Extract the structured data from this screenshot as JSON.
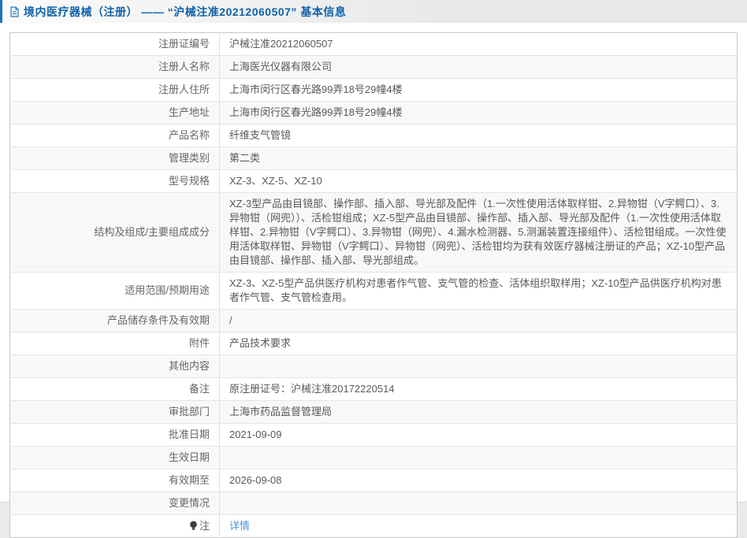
{
  "header": {
    "title": "境内医疗器械（注册） —— “沪械注准20212060507” 基本信息"
  },
  "colors": {
    "title_blue": "#0f62a7",
    "accent_border_blue": "#2272b9",
    "link_blue": "#4e94d9",
    "page_bg": "#eaeaea",
    "table_outer_border": "#c8c8c8",
    "row_divider": "#e4e4e4",
    "text_gray": "#595959"
  },
  "table": {
    "rows": [
      {
        "label": "注册证编号",
        "value": "沪械注准20212060507"
      },
      {
        "label": "注册人名称",
        "value": "上海医光仪器有限公司"
      },
      {
        "label": "注册人住所",
        "value": "上海市闵行区春光路99弄18号29幢4楼"
      },
      {
        "label": "生产地址",
        "value": "上海市闵行区春光路99弄18号29幢4楼"
      },
      {
        "label": "产品名称",
        "value": "纤维支气管镜"
      },
      {
        "label": "管理类别",
        "value": "第二类"
      },
      {
        "label": "型号规格",
        "value": "XZ-3、XZ-5、XZ-10"
      },
      {
        "label": "结构及组成/主要组成成分",
        "value": "XZ-3型产品由目镜部、操作部、插入部、导光部及配件（1.一次性使用活体取样钳、2.异物钳（V字鳄口）、3.异物钳（网兜））、活检钳组成；XZ-5型产品由目镜部、操作部、插入部、导光部及配件（1.一次性使用活体取样钳、2.异物钳（V字鳄口）、3.异物钳（网兜）、4.漏水检测器、5.测漏装置连接组件）、活检钳组成。一次性使用活体取样钳、异物钳（V字鳄口）、异物钳（网兜）、活检钳均为获有效医疗器械注册证的产品；XZ-10型产品由目镜部、操作部、插入部、导光部组成。"
      },
      {
        "label": "适用范围/预期用途",
        "value": "XZ-3、XZ-5型产品供医疗机构对患者作气管、支气管的检查、活体组织取样用；XZ-10型产品供医疗机构对患者作气管、支气管检查用。"
      },
      {
        "label": "产品储存条件及有效期",
        "value": "/"
      },
      {
        "label": "附件",
        "value": "产品技术要求"
      },
      {
        "label": "其他内容",
        "value": ""
      },
      {
        "label": "备注",
        "value": "原注册证号：沪械注准20172220514"
      },
      {
        "label": "审批部门",
        "value": "上海市药品监督管理局"
      },
      {
        "label": "批准日期",
        "value": "2021-09-09"
      },
      {
        "label": "生效日期",
        "value": ""
      },
      {
        "label": "有效期至",
        "value": "2026-09-08"
      },
      {
        "label": "变更情况",
        "value": ""
      },
      {
        "label": "注",
        "value": "详情",
        "link": true,
        "icon": "note-bulb-icon"
      }
    ]
  }
}
